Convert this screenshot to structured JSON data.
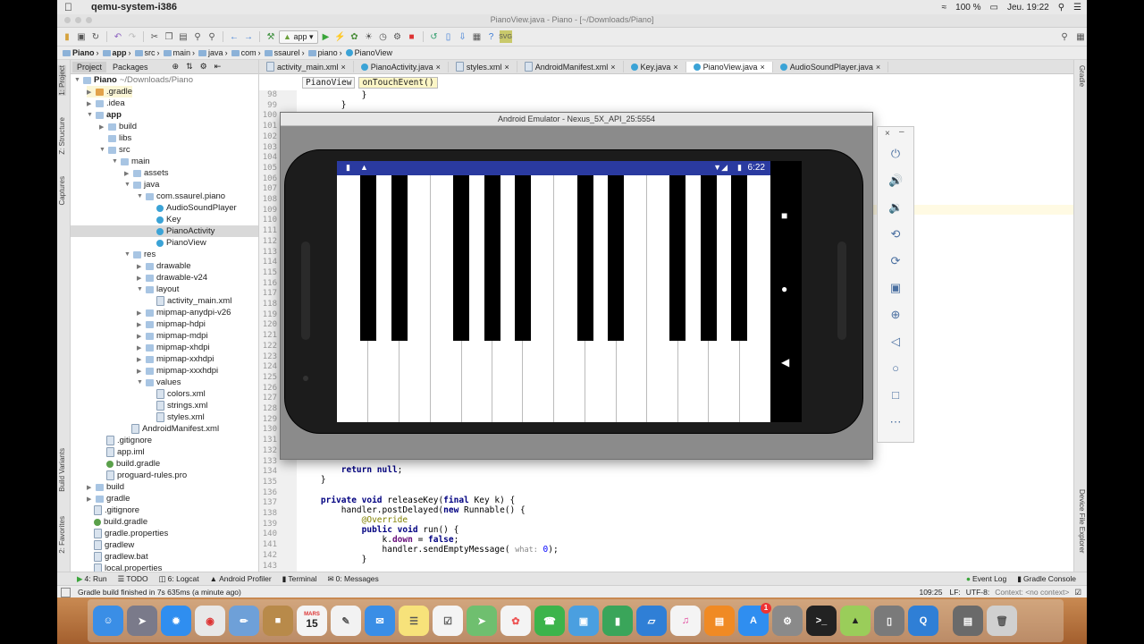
{
  "menubar": {
    "app_name": "qemu-system-i386",
    "battery": "100 %",
    "clock": "Jeu. 19:22"
  },
  "window": {
    "title": "PianoView.java - Piano - [~/Downloads/Piano]"
  },
  "toolbar": {
    "run_config": "app"
  },
  "breadcrumbs": [
    "Piano",
    "app",
    "src",
    "main",
    "java",
    "com",
    "ssaurel",
    "piano",
    "PianoView"
  ],
  "left_strip": {
    "project": "1: Project",
    "structure": "Z: Structure",
    "captures": "Captures",
    "build_variants": "Build Variants",
    "favorites": "2: Favorites"
  },
  "right_strip": {
    "gradle": "Gradle",
    "device_explorer": "Device File Explorer"
  },
  "project_panel": {
    "tabs": [
      "Project",
      "Packages"
    ],
    "items": [
      {
        "label": "Piano",
        "suffix": "~/Downloads/Piano"
      },
      {
        "label": ".gradle"
      },
      {
        "label": ".idea"
      },
      {
        "label": "app"
      },
      {
        "label": "build"
      },
      {
        "label": "libs"
      },
      {
        "label": "src"
      },
      {
        "label": "main"
      },
      {
        "label": "assets"
      },
      {
        "label": "java"
      },
      {
        "label": "com.ssaurel.piano"
      },
      {
        "label": "AudioSoundPlayer"
      },
      {
        "label": "Key"
      },
      {
        "label": "PianoActivity"
      },
      {
        "label": "PianoView"
      },
      {
        "label": "res"
      },
      {
        "label": "drawable"
      },
      {
        "label": "drawable-v24"
      },
      {
        "label": "layout"
      },
      {
        "label": "activity_main.xml"
      },
      {
        "label": "mipmap-anydpi-v26"
      },
      {
        "label": "mipmap-hdpi"
      },
      {
        "label": "mipmap-mdpi"
      },
      {
        "label": "mipmap-xhdpi"
      },
      {
        "label": "mipmap-xxhdpi"
      },
      {
        "label": "mipmap-xxxhdpi"
      },
      {
        "label": "values"
      },
      {
        "label": "colors.xml"
      },
      {
        "label": "strings.xml"
      },
      {
        "label": "styles.xml"
      },
      {
        "label": "AndroidManifest.xml"
      },
      {
        "label": ".gitignore"
      },
      {
        "label": "app.iml"
      },
      {
        "label": "build.gradle"
      },
      {
        "label": "proguard-rules.pro"
      },
      {
        "label": "build"
      },
      {
        "label": "gradle"
      },
      {
        "label": ".gitignore"
      },
      {
        "label": "build.gradle"
      },
      {
        "label": "gradle.properties"
      },
      {
        "label": "gradlew"
      },
      {
        "label": "gradlew.bat"
      },
      {
        "label": "local.properties"
      }
    ]
  },
  "editor": {
    "tabs": [
      "activity_main.xml",
      "PianoActivity.java",
      "styles.xml",
      "AndroidManifest.xml",
      "Key.java",
      "PianoView.java",
      "AudioSoundPlayer.java"
    ],
    "active_tab": "PianoView.java",
    "crumb_class": "PianoView",
    "crumb_method": "onTouchEvent()",
    "line_numbers": [
      "98",
      "99",
      "100",
      "101",
      "102",
      "103",
      "104",
      "105",
      "106",
      "107",
      "108",
      "109",
      "110",
      "111",
      "112",
      "113",
      "114",
      "115",
      "116",
      "117",
      "118",
      "119",
      "120",
      "121",
      "122",
      "123",
      "124",
      "125",
      "126",
      "127",
      "128",
      "129",
      "130",
      "131",
      "132",
      "133",
      "134",
      "135",
      "136",
      "137",
      "138",
      "139",
      "140",
      "141",
      "142",
      "143"
    ],
    "visible_code": {
      "l98": "            }",
      "l99": "        }",
      "l134": "        return null;",
      "l135": "    }",
      "l136": "",
      "l137": "    private void releaseKey(final Key k) {",
      "l138": "        handler.postDelayed(new Runnable() {",
      "l139": "            @Override",
      "l140": "            public void run() {",
      "l141": "                k.down = false;",
      "l142": "                handler.sendEmptyMessage( what: 0);",
      "l143": "            }"
    }
  },
  "emulator": {
    "title": "Android Emulator - Nexus_5X_API_25:5554",
    "status_time": "6:22"
  },
  "bottom_tools": {
    "run": "4: Run",
    "todo": "TODO",
    "logcat": "6: Logcat",
    "profiler": "Android Profiler",
    "terminal": "Terminal",
    "messages": "0: Messages",
    "event_log": "Event Log",
    "gradle_console": "Gradle Console"
  },
  "status": {
    "message": "Gradle build finished in 7s 635ms (a minute ago)",
    "position": "109:25",
    "line_sep": "LF:",
    "encoding": "UTF-8:",
    "context": "Context: <no context>"
  },
  "dock": {
    "calendar_month": "MARS",
    "calendar_day": "15",
    "appstore_badge": "1"
  }
}
